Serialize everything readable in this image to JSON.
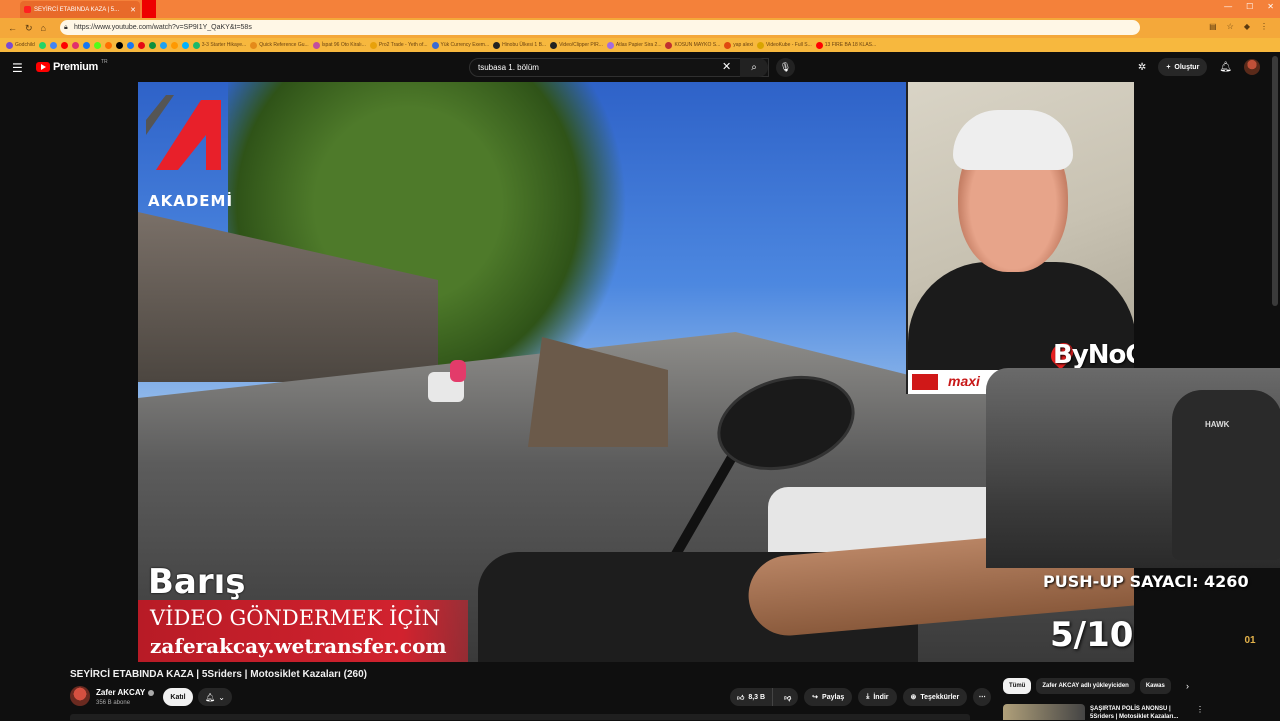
{
  "browser": {
    "tab_title": "SEYİRCİ ETABINDA KAZA | 5...",
    "url": "https://www.youtube.com/watch?v=SP9I1Y_QaKY&t=58s",
    "bookmarks": [
      {
        "label": "Godchild",
        "color": "#7a4bd1"
      },
      {
        "label": "",
        "color": "#25d366"
      },
      {
        "label": "",
        "color": "#4285f4"
      },
      {
        "label": "",
        "color": "#ff0000"
      },
      {
        "label": "",
        "color": "#e1306c"
      },
      {
        "label": "",
        "color": "#1877f2"
      },
      {
        "label": "",
        "color": "#53fc18"
      },
      {
        "label": "",
        "color": "#ff6f00"
      },
      {
        "label": "",
        "color": "#000000"
      },
      {
        "label": "",
        "color": "#1877f2"
      },
      {
        "label": "",
        "color": "#e50914"
      },
      {
        "label": "",
        "color": "#0e8f3d"
      },
      {
        "label": "",
        "color": "#1da1f2"
      },
      {
        "label": "",
        "color": "#ff9900"
      },
      {
        "label": "",
        "color": "#00b2ff"
      },
      {
        "label": "3-3 Starter Hikaye...",
        "color": "#1ab86a"
      },
      {
        "label": "Quick Reference Gu...",
        "color": "#e48a1a"
      },
      {
        "label": "İspat 96 Oto Kiralı...",
        "color": "#c14e9e"
      },
      {
        "label": "Pro2 Trade - Yeth of...",
        "color": "#e8a10a"
      },
      {
        "label": "Yük Currency Exem...",
        "color": "#3b6bd4"
      },
      {
        "label": "Hinobu Ülkesi 1 B...",
        "color": "#222222"
      },
      {
        "label": "Video/Clipper PIR...",
        "color": "#222222"
      },
      {
        "label": "Atlas Papier Sira 2...",
        "color": "#a36cde"
      },
      {
        "label": "KOSUN MAYKO S...",
        "color": "#c03030"
      },
      {
        "label": "yap alexi",
        "color": "#e04a10"
      },
      {
        "label": "VideoKube - Full S...",
        "color": "#d9a400"
      },
      {
        "label": "13 FIRE BA 18 KLAS...",
        "color": "#ff0000"
      }
    ]
  },
  "header": {
    "logo_text": "Premium",
    "logo_region": "TR",
    "search_value": "tsubasa 1. bölüm",
    "create_label": "Oluştur"
  },
  "video": {
    "academy_label": "AKADEMİ",
    "name_tag": "Barış",
    "banner_line1": "VİDEO GÖNDERMEK İÇİN",
    "banner_line2": "zaferakcay.wetransfer.com",
    "maxi_label": "maxi",
    "bynogame": "ByNoGame",
    "chair_brand": "HAWK",
    "pushup_counter": "PUSH-UP SAYACI: 4260",
    "score": "5/10",
    "side_logo": "01"
  },
  "info": {
    "title": "SEYİRCİ ETABINDA KAZA | 5Sriders | Motosiklet Kazaları (260)",
    "channel": "Zafer AKCAY",
    "subscribers": "356 B abone",
    "join_label": "Katıl",
    "likes": "8,3 B",
    "share_label": "Paylaş",
    "download_label": "İndir",
    "thanks_label": "Teşekkürler"
  },
  "chips": [
    "Tümü",
    "Zafer AKCAY adlı yükleyiciden",
    "Kawas"
  ],
  "recommendation": {
    "title": "ŞAŞIRTAN POLİS ANONSU | 5Sriders | Motosiklet Kazaları..."
  }
}
